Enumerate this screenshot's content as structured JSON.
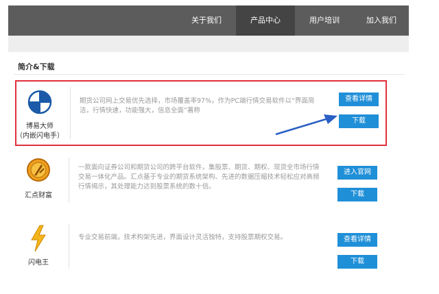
{
  "nav": {
    "items": [
      {
        "label": "关于我们",
        "active": false
      },
      {
        "label": "产品中心",
        "active": true
      },
      {
        "label": "用户培训",
        "active": false
      },
      {
        "label": "加入我们",
        "active": false
      }
    ]
  },
  "section": {
    "title": "简介&下载"
  },
  "products": [
    {
      "name_line1": "博易大师",
      "name_line2": "（内嵌闪电手）",
      "desc": "期货公司网上交易优先选择，市场覆盖率97%，作为PC端行情交易软件以“界面简洁，行情快速，功能强大，信息全面”著称",
      "buttons": [
        "查看详情",
        "下载"
      ],
      "icon": "boyi-logo-icon"
    },
    {
      "name_line1": "汇点财富",
      "desc": "一款面向证券公司和期货公司的跨平台软件，集股票、期货、期权、现货全市场行情交易一体化产品。汇点基于专业的期货系统架构、先进的数据压缩技术轻松应对高频行情揭示，其处理能力达到股票系统的数十倍。",
      "buttons": [
        "进入官网",
        "下载"
      ],
      "icon": "huidian-logo-icon"
    },
    {
      "name_line1": "闪电王",
      "desc": "专业交易前端，技术构架先进，界面设计灵活独特，支持股票期权交易。",
      "buttons": [
        "查看详情",
        "下载"
      ],
      "icon": "lightning-icon"
    }
  ],
  "colors": {
    "nav_bg": "#5c5c5c",
    "nav_active": "#444444",
    "button": "#1f8fd8",
    "highlight_border": "#e0303a",
    "annotation_arrow": "#2a5fc4"
  }
}
